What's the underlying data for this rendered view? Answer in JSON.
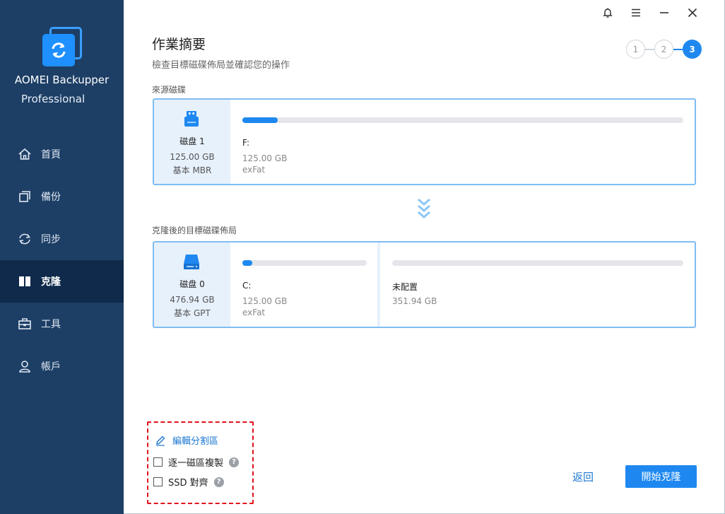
{
  "app": {
    "name": "AOMEI Backupper",
    "edition": "Professional"
  },
  "sidebar": {
    "items": [
      {
        "label": "首頁",
        "icon": "home-icon",
        "active": false
      },
      {
        "label": "備份",
        "icon": "backup-icon",
        "active": false
      },
      {
        "label": "同步",
        "icon": "sync-icon",
        "active": false
      },
      {
        "label": "克隆",
        "icon": "clone-icon",
        "active": true
      },
      {
        "label": "工具",
        "icon": "tools-icon",
        "active": false
      },
      {
        "label": "帳戶",
        "icon": "account-icon",
        "active": false
      }
    ]
  },
  "titlebar": {
    "icons": [
      "bell-icon",
      "menu-icon",
      "minimize-icon",
      "close-icon"
    ]
  },
  "header": {
    "title": "作業摘要",
    "subtitle": "檢查目標磁碟佈局並確認您的操作"
  },
  "steps": {
    "items": [
      "1",
      "2",
      "3"
    ],
    "current": 3
  },
  "source": {
    "section_label": "來源磁碟",
    "disk": {
      "name": "磁盘 1",
      "size": "125.00 GB",
      "type": "基本 MBR",
      "icon": "usb-disk-icon"
    },
    "partitions": [
      {
        "letter": "F:",
        "size": "125.00 GB",
        "fs": "exFat",
        "used_fraction": 0.08
      }
    ]
  },
  "destination": {
    "section_label": "克隆後的目標磁碟佈局",
    "disk": {
      "name": "磁盘 0",
      "size": "476.94 GB",
      "type": "基本 GPT",
      "icon": "hard-disk-icon"
    },
    "partitions": [
      {
        "letter": "C:",
        "size": "125.00 GB",
        "fs": "exFat",
        "used_fraction": 0.08
      },
      {
        "letter": "未配置",
        "size": "351.94 GB",
        "fs": "",
        "used_fraction": 0
      }
    ]
  },
  "options": {
    "edit_partitions": "編輯分割區",
    "sector_by_sector": "逐一磁區複製",
    "ssd_align": "SSD 對齊",
    "help_glyph": "?"
  },
  "actions": {
    "back": "返回",
    "start": "開始克隆"
  },
  "colors": {
    "sidebar_bg": "#1d3f66",
    "sidebar_active": "#0f2a4a",
    "accent": "#1e88f0",
    "highlight_box": "#e0121b"
  }
}
